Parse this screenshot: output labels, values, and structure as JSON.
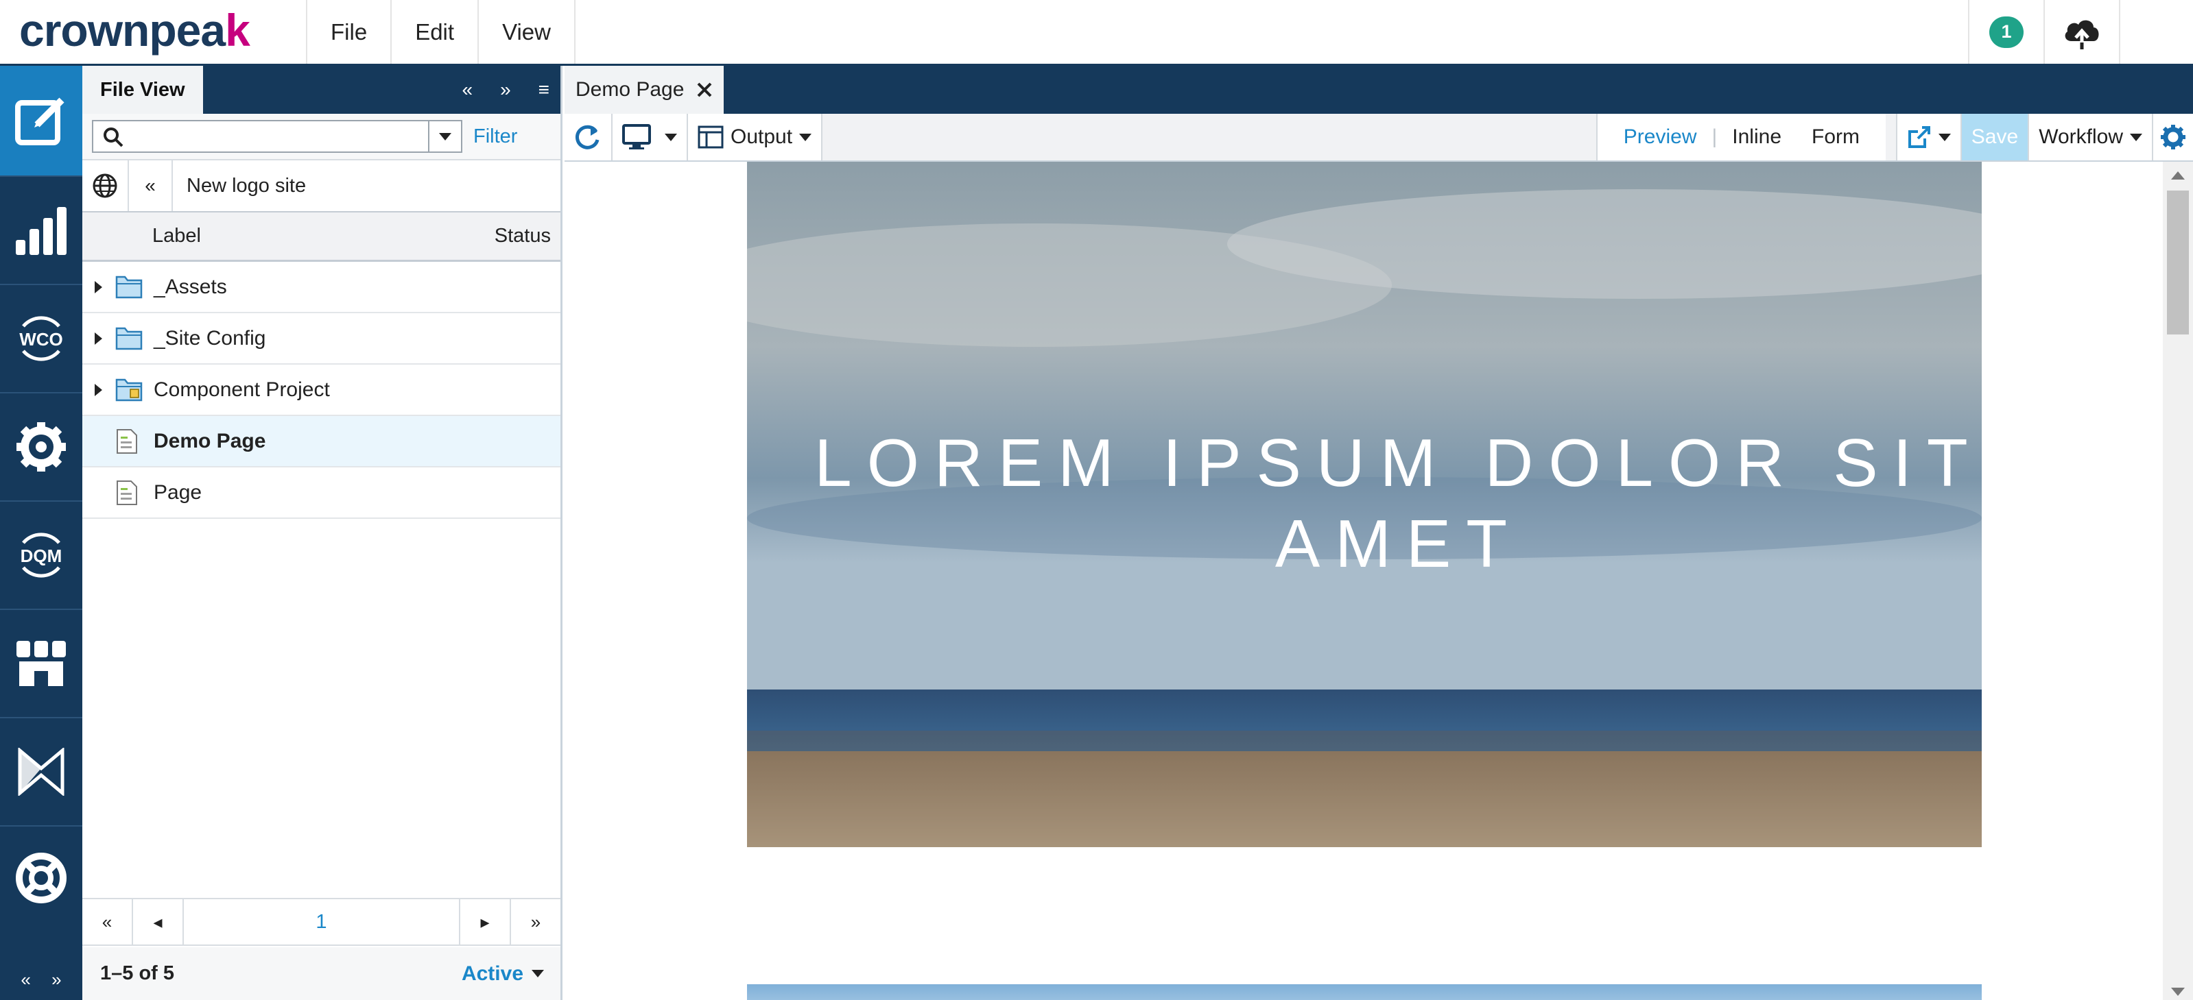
{
  "brand": {
    "logo_main": "crownpea",
    "logo_accent": "k"
  },
  "menu": {
    "file": "File",
    "edit": "Edit",
    "view": "View"
  },
  "topright": {
    "notifications": "1",
    "upload_icon": "cloud-upload-icon"
  },
  "leftnav": {
    "items": [
      "edit-icon",
      "analytics-icon",
      "wco-icon",
      "settings-icon",
      "dqm-icon",
      "marketplace-icon",
      "connector-icon",
      "help-icon"
    ],
    "wco_label": "WCO",
    "dqm_label": "DQM"
  },
  "panel": {
    "tab": "File View",
    "search_placeholder": "",
    "filter": "Filter",
    "site": "New logo site",
    "columns": {
      "label": "Label",
      "status": "Status"
    },
    "rows": [
      {
        "label": "_Assets",
        "type": "folder"
      },
      {
        "label": "_Site Config",
        "type": "folder"
      },
      {
        "label": "Component Project",
        "type": "project"
      },
      {
        "label": "Demo Page",
        "type": "page",
        "selected": true
      },
      {
        "label": "Page",
        "type": "page"
      }
    ],
    "page_number": "1",
    "count": "1–5 of 5",
    "filter_state": "Active"
  },
  "main": {
    "tab": "Demo Page",
    "output": "Output",
    "modes": {
      "preview": "Preview",
      "inline": "Inline",
      "form": "Form"
    },
    "save": "Save",
    "workflow": "Workflow"
  },
  "preview": {
    "hero_line1": "LOREM IPSUM DOLOR SIT",
    "hero_line2": "AMET"
  },
  "colors": {
    "navy": "#15395b",
    "accent_blue": "#1a87c9",
    "active_nav": "#1a7fbf",
    "brand_pink": "#c6007e",
    "badge_green": "#1fa389"
  }
}
